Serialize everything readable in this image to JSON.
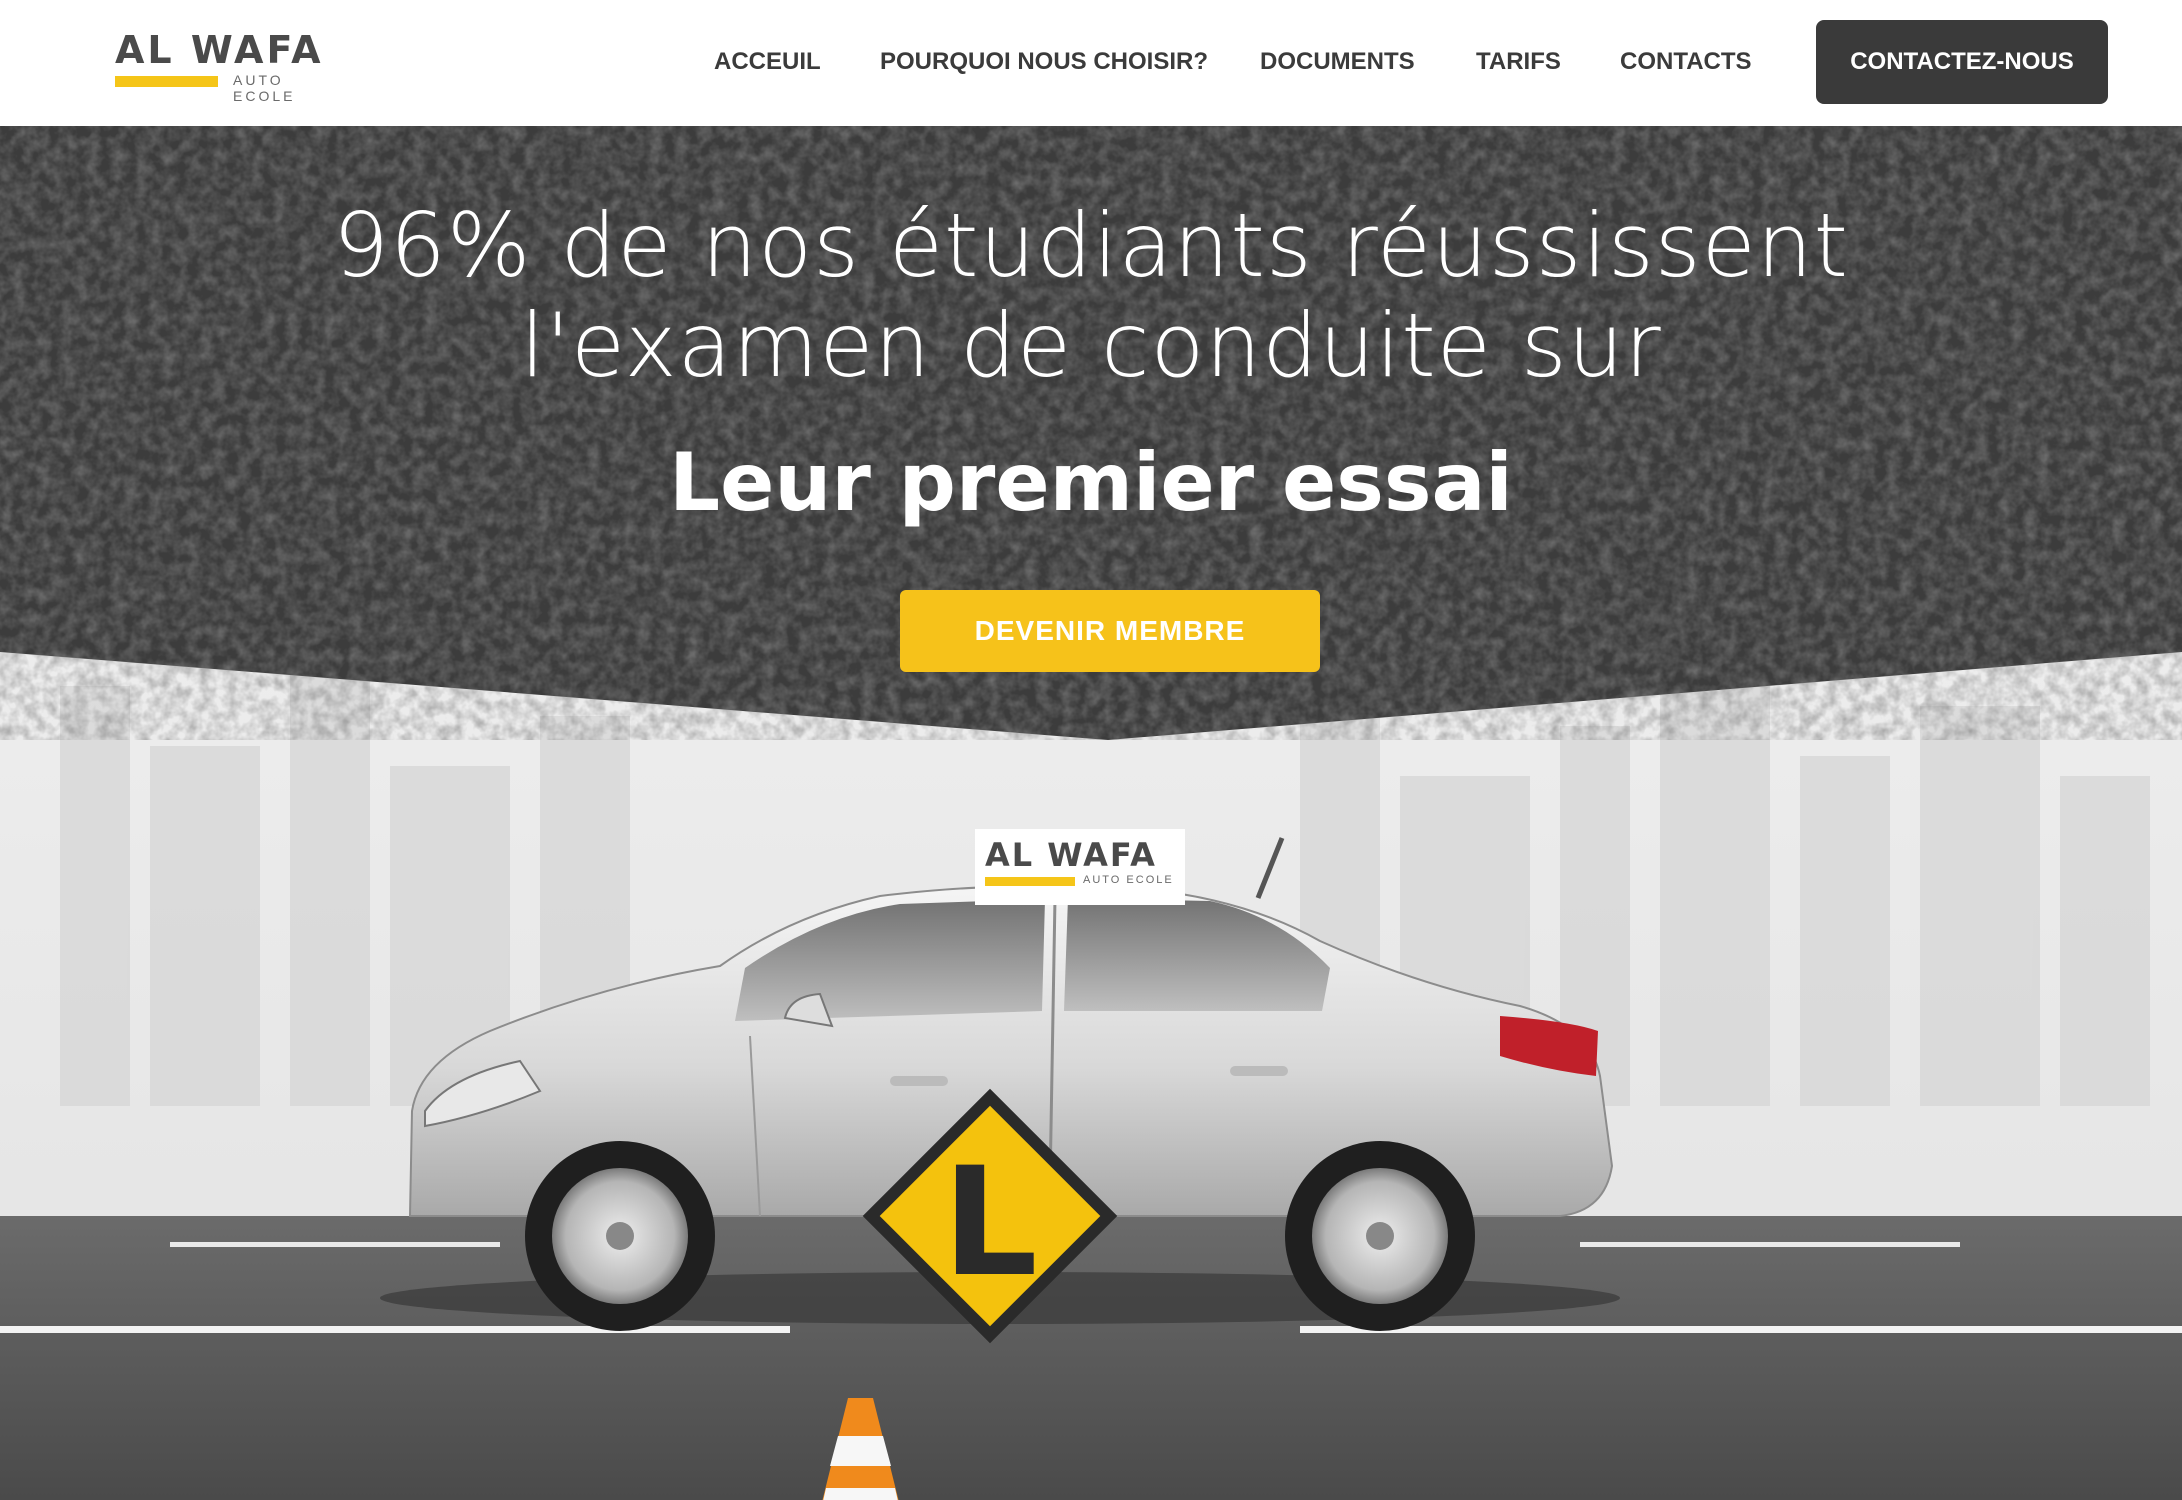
{
  "brand": {
    "name": "AL WAFA",
    "tagline": "AUTO ECOLE",
    "accent_color": "#f5c518",
    "dark_color": "#3a3a3a"
  },
  "nav": {
    "items": [
      {
        "label": "ACCEUIL"
      },
      {
        "label": "POURQUOI NOUS CHOISIR?"
      },
      {
        "label": "DOCUMENTS"
      },
      {
        "label": "TARIFS"
      },
      {
        "label": "CONTACTS"
      }
    ],
    "cta_label": "CONTACTEZ-NOUS"
  },
  "hero": {
    "headline_line1": "96% de nos étudiants réussissent",
    "headline_line2": "l'examen de conduite sur",
    "subheadline": "Leur premier essai",
    "cta_label": "DEVENIR MEMBRE"
  },
  "car": {
    "roof_sign_name": "AL WAFA",
    "roof_sign_tagline": "AUTO ECOLE",
    "learner_plate_letter": "L"
  }
}
